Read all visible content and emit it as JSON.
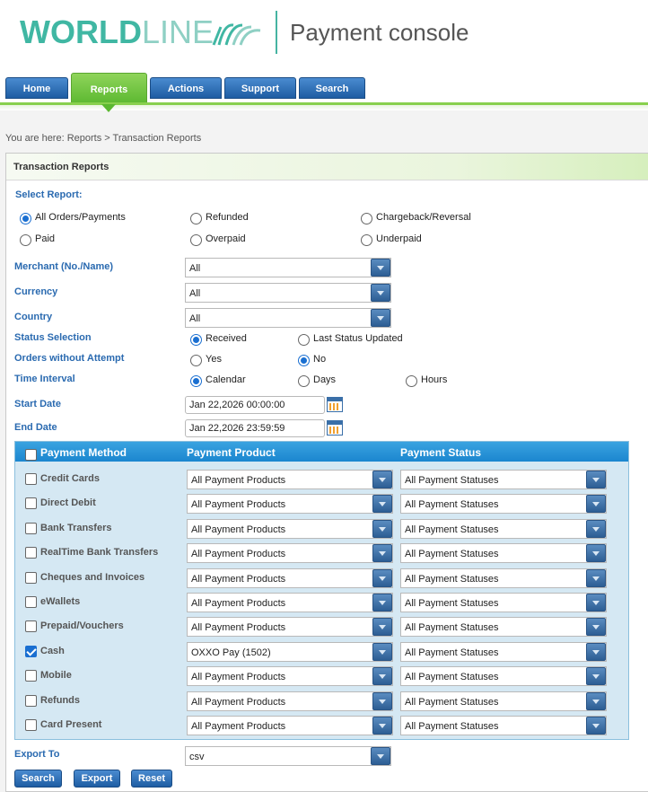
{
  "header": {
    "logo_world": "WORLD",
    "logo_line": "LINE",
    "title": "Payment console"
  },
  "nav": [
    "Home",
    "Reports",
    "Actions",
    "Support",
    "Search"
  ],
  "breadcrumb": "You are here: Reports > Transaction Reports",
  "panel": {
    "title": "Transaction Reports"
  },
  "select_report": {
    "label": "Select Report:",
    "options": [
      "All Orders/Payments",
      "Refunded",
      "Chargeback/Reversal",
      "Paid",
      "Overpaid",
      "Underpaid"
    ],
    "selected": "All Orders/Payments"
  },
  "merchant": {
    "label": "Merchant (No./Name)",
    "value": "All"
  },
  "currency": {
    "label": "Currency",
    "value": "All"
  },
  "country": {
    "label": "Country",
    "value": "All"
  },
  "status_selection": {
    "label": "Status Selection",
    "options": [
      "Received",
      "Last Status Updated"
    ],
    "selected": "Received"
  },
  "orders_without_attempt": {
    "label": "Orders without Attempt",
    "options": [
      "Yes",
      "No"
    ],
    "selected": "No"
  },
  "time_interval": {
    "label": "Time Interval",
    "options": [
      "Calendar",
      "Days",
      "Hours"
    ],
    "selected": "Calendar"
  },
  "start_date": {
    "label": "Start Date",
    "value": "Jan 22,2026 00:00:00"
  },
  "end_date": {
    "label": "End Date",
    "value": "Jan 22,2026 23:59:59"
  },
  "payment_table": {
    "headers": [
      "Payment Method",
      "Payment Product",
      "Payment Status"
    ],
    "rows": [
      {
        "method": "Credit Cards",
        "checked": false,
        "product": "All Payment Products",
        "status": "All Payment Statuses"
      },
      {
        "method": "Direct Debit",
        "checked": false,
        "product": "All Payment Products",
        "status": "All Payment Statuses"
      },
      {
        "method": "Bank Transfers",
        "checked": false,
        "product": "All Payment Products",
        "status": "All Payment Statuses"
      },
      {
        "method": "RealTime Bank Transfers",
        "checked": false,
        "product": "All Payment Products",
        "status": "All Payment Statuses"
      },
      {
        "method": "Cheques and Invoices",
        "checked": false,
        "product": "All Payment Products",
        "status": "All Payment Statuses"
      },
      {
        "method": "eWallets",
        "checked": false,
        "product": "All Payment Products",
        "status": "All Payment Statuses"
      },
      {
        "method": "Prepaid/Vouchers",
        "checked": false,
        "product": "All Payment Products",
        "status": "All Payment Statuses"
      },
      {
        "method": "Cash",
        "checked": true,
        "product": "OXXO Pay (1502)",
        "status": "All Payment Statuses"
      },
      {
        "method": "Mobile",
        "checked": false,
        "product": "All Payment Products",
        "status": "All Payment Statuses"
      },
      {
        "method": "Refunds",
        "checked": false,
        "product": "All Payment Products",
        "status": "All Payment Statuses"
      },
      {
        "method": "Card Present",
        "checked": false,
        "product": "All Payment Products",
        "status": "All Payment Statuses"
      }
    ]
  },
  "export_to": {
    "label": "Export To",
    "value": "csv"
  },
  "buttons": {
    "search": "Search",
    "export": "Export",
    "reset": "Reset"
  },
  "colors": {
    "brand_teal": "#40b7a3",
    "nav_blue": "#1e5da3",
    "nav_active_green": "#5bb830",
    "label_blue": "#2a6ab0",
    "table_header_blue": "#1b86cf"
  }
}
